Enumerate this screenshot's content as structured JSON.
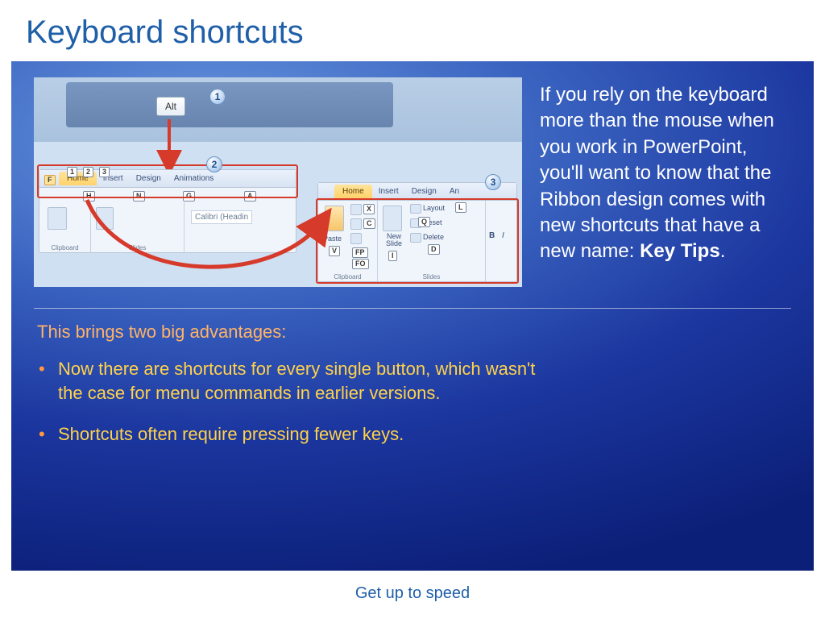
{
  "title": "Keyboard shortcuts",
  "paragraph": "If you rely on the keyboard more than the mouse when you work in PowerPoint, you'll want to know that the Ribbon design comes with new shortcuts that have a new name: ",
  "paragraph_bold": "Key Tips",
  "paragraph_end": ".",
  "subhead": "This brings two big advantages:",
  "bullets": [
    "Now there are shortcuts for every single button, which wasn't the case for menu commands in earlier versions.",
    "Shortcuts often require pressing fewer keys."
  ],
  "footer": "Get up to speed",
  "illus": {
    "alt_key": "Alt",
    "steps": {
      "s1": "1",
      "s2": "2",
      "s3": "3"
    },
    "ribbon1": {
      "tabs": [
        "Home",
        "Insert",
        "Design",
        "Animations"
      ],
      "tab_keys": [
        "H",
        "N",
        "G",
        "A"
      ],
      "qat_keys": [
        "F",
        "1",
        "2",
        "3"
      ],
      "groups": [
        "Clipboard",
        "Slides"
      ],
      "font_preview": "Calibri (Headin"
    },
    "ribbon2": {
      "tabs": [
        "Home",
        "Insert",
        "Design",
        "An"
      ],
      "groups": [
        "Clipboard",
        "Slides"
      ],
      "cmd_labels": {
        "paste": "Paste",
        "new_slide": "New Slide",
        "layout": "Layout",
        "reset": "Reset",
        "delete": "Delete"
      },
      "cmd_keys": {
        "paste": "V",
        "cut": "X",
        "copy": "C",
        "fp": "FP",
        "fo": "FO",
        "new": "I",
        "layout": "L",
        "reset": "Q",
        "delete": "D"
      },
      "fmt": {
        "b": "B",
        "i": "I"
      }
    }
  }
}
